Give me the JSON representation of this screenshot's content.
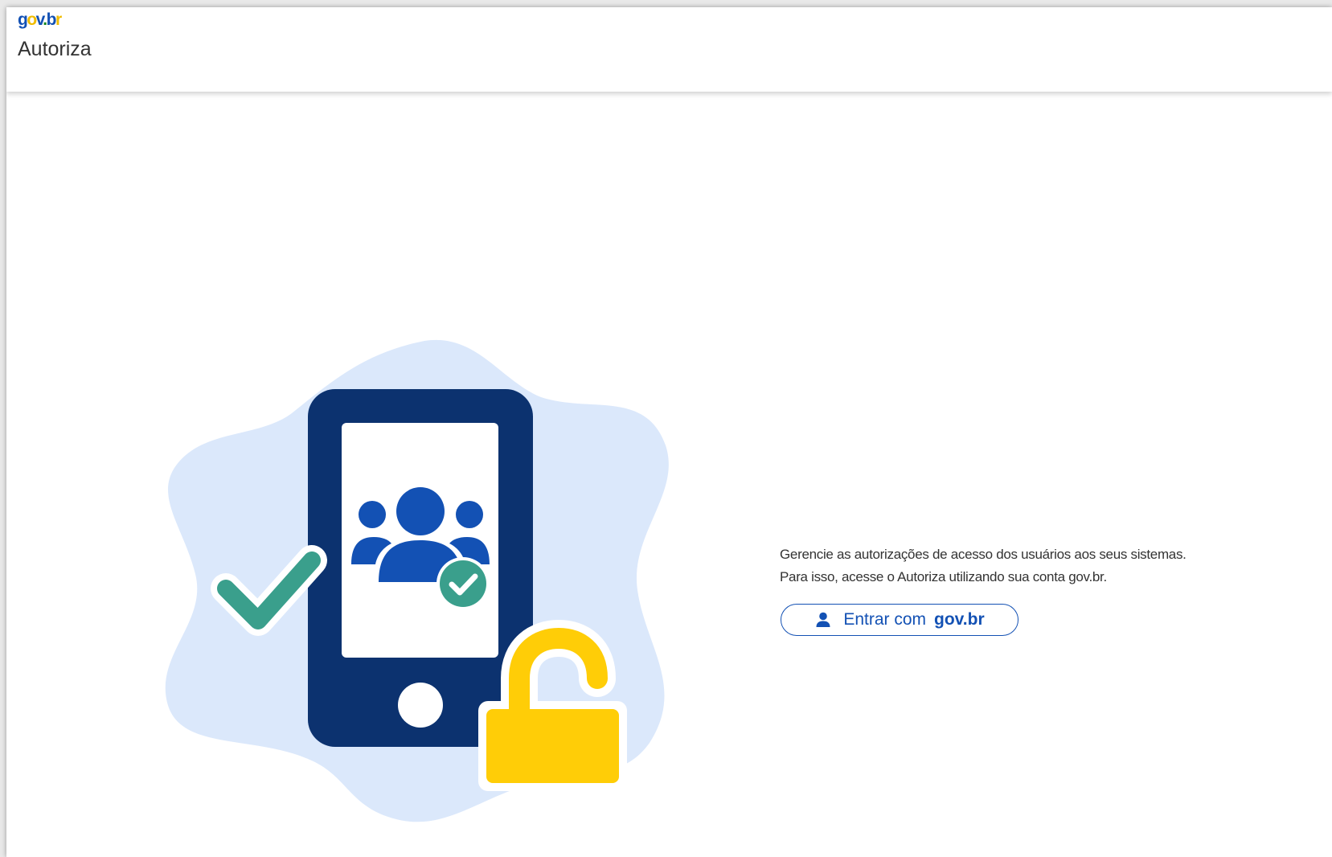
{
  "header": {
    "logo": {
      "g": "g",
      "o": "o",
      "v": "v",
      "b": "b",
      "r": "r"
    },
    "app_title": "Autoriza"
  },
  "main": {
    "intro_line1": "Gerencie as autorizações de acesso dos usuários aos seus sistemas.",
    "intro_line2": "Para isso, acesse o Autoriza utilizando sua conta gov.br.",
    "login_button": {
      "label": "Entrar com",
      "brand": "gov.br",
      "icon": "user-icon"
    }
  },
  "illustration": {
    "elements": [
      "blob",
      "phone-icon",
      "users-icon",
      "check-badge-icon",
      "checkmark-icon",
      "unlocked-padlock-icon"
    ]
  },
  "colors": {
    "primary_blue": "#1351b4",
    "dark_navy": "#0c326f",
    "blob_light_blue": "#dbe8fb",
    "teal_green": "#3a9f8c",
    "padlock_yellow": "#ffcd07"
  }
}
